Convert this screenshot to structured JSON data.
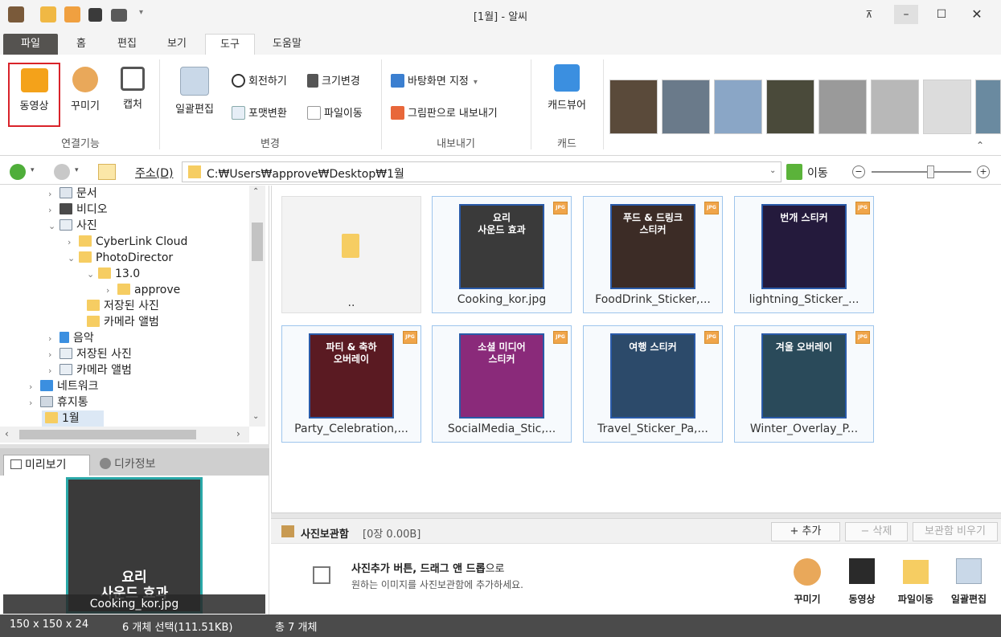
{
  "window": {
    "title": "[1월] - 알씨"
  },
  "tabs": [
    {
      "label": "파일"
    },
    {
      "label": "홈"
    },
    {
      "label": "편집"
    },
    {
      "label": "보기"
    },
    {
      "label": "도구"
    },
    {
      "label": "도움말"
    }
  ],
  "ribbon": {
    "video": "동영상",
    "decorate": "꾸미기",
    "capture": "캡처",
    "batch": "일괄편집",
    "rotate": "회전하기",
    "resize": "크기변경",
    "format": "포맷변환",
    "move": "파일이동",
    "wallpaper": "바탕화면 지정",
    "export": "그림판으로 내보내기",
    "cardviewer": "캐드뷰어",
    "groups": {
      "connect": "연결기능",
      "change": "변경",
      "export": "내보내기",
      "card": "캐드"
    }
  },
  "address": {
    "label": "주소(D)",
    "path": "C:₩Users₩approve₩Desktop₩1월",
    "go": "이동"
  },
  "tree": [
    {
      "label": "문서"
    },
    {
      "label": "비디오"
    },
    {
      "label": "사진"
    },
    {
      "label": "CyberLink Cloud"
    },
    {
      "label": "PhotoDirector"
    },
    {
      "label": "13.0"
    },
    {
      "label": "approve"
    },
    {
      "label": "저장된 사진"
    },
    {
      "label": "카메라 앨범"
    },
    {
      "label": "음악"
    },
    {
      "label": "저장된 사진"
    },
    {
      "label": "카메라 앨범"
    },
    {
      "label": "네트워크"
    },
    {
      "label": "휴지통"
    },
    {
      "label": "1월"
    }
  ],
  "preview": {
    "tab1": "미리보기",
    "tab2": "디카정보",
    "caption": "Cooking_kor.jpg",
    "img_text": "요리\n사운드 효과"
  },
  "files": [
    {
      "name": "..",
      "img_text": "",
      "color": "#f3f3f3"
    },
    {
      "name": "Cooking_kor.jpg",
      "img_text": "요리\n사운드 효과",
      "color": "#3a3a3a"
    },
    {
      "name": "FoodDrink_Sticker,...",
      "img_text": "푸드 & 드링크\n스티커",
      "color": "#3c2c26"
    },
    {
      "name": "lightning_Sticker_...",
      "img_text": "번개 스티커",
      "color": "#241a3c"
    },
    {
      "name": "Party_Celebration,...",
      "img_text": "파티 & 축하\n오버레이",
      "color": "#5a1a22"
    },
    {
      "name": "SocialMedia_Stic,...",
      "img_text": "소셜 미디어\n스티커",
      "color": "#8a2a7a"
    },
    {
      "name": "Travel_Sticker_Pa,...",
      "img_text": "여행 스티커",
      "color": "#2c4a6a"
    },
    {
      "name": "Winter_Overlay_P...",
      "img_text": "겨울 오버레이",
      "color": "#2a4a5a"
    }
  ],
  "storage": {
    "title": "사진보관함",
    "info": "[0장 0.00B]",
    "add": "+ 추가",
    "delete": "− 삭제",
    "clear": "보관함 비우기",
    "hint_bold": "사진추가 버튼, 드래그 앤 드롭",
    "hint_suffix": "으로",
    "hint_line2": "원하는 이미지를 사진보관함에 추가하세요.",
    "buttons": {
      "decorate": "꾸미기",
      "video": "동영상",
      "move": "파일이동",
      "batch": "일괄편집"
    }
  },
  "status": {
    "dims": "150 x 150 x 24",
    "selected": "6 개체 선택(111.51KB)",
    "total": "총 7 개체"
  },
  "colors": {
    "accent": "#d9232a",
    "selection": "#9ec5ec",
    "statusbar": "#4b4b4b",
    "filetab": "#555350"
  },
  "zoom": {
    "level": 0.6
  }
}
